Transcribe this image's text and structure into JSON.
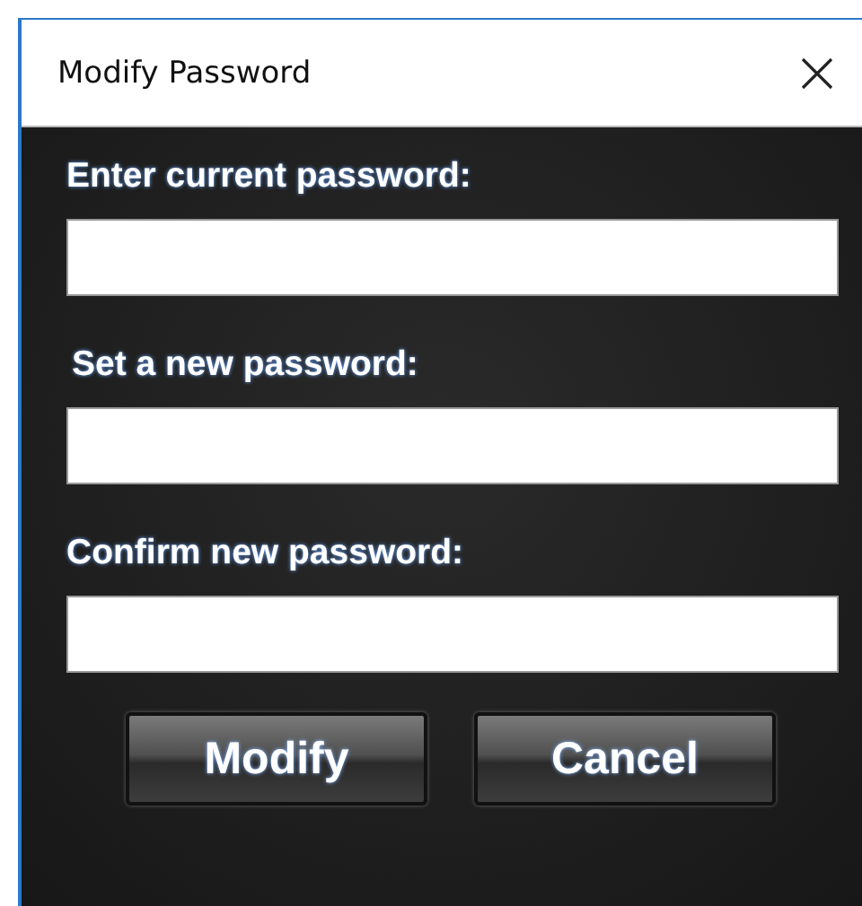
{
  "window": {
    "title": "Modify Password"
  },
  "fields": [
    {
      "label": "Enter current password:"
    },
    {
      "label": "Set a new password:"
    },
    {
      "label": "Confirm new password:"
    }
  ],
  "buttons": [
    {
      "label": "Modify"
    },
    {
      "label": "Cancel"
    }
  ]
}
